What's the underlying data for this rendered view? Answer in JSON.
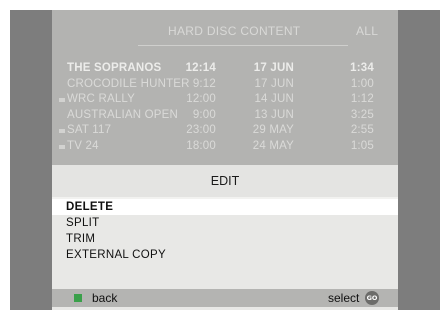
{
  "header": {
    "title": "HARD DISC CONTENT",
    "filter": "ALL"
  },
  "recordings": [
    {
      "name": "THE SOPRANOS",
      "time": "12:14",
      "date": "17 JUN",
      "length": "1:34",
      "marked": false,
      "highlighted": true
    },
    {
      "name": "CROCODILE HUNTER",
      "time": "9:12",
      "date": "17 JUN",
      "length": "1:00",
      "marked": false,
      "highlighted": false
    },
    {
      "name": "WRC RALLY",
      "time": "12:00",
      "date": "14 JUN",
      "length": "1:12",
      "marked": true,
      "highlighted": false
    },
    {
      "name": "AUSTRALIAN OPEN",
      "time": "9:00",
      "date": "13 JUN",
      "length": "3:25",
      "marked": false,
      "highlighted": false
    },
    {
      "name": "SAT 117",
      "time": "23:00",
      "date": "29 MAY",
      "length": "2:55",
      "marked": true,
      "highlighted": false
    },
    {
      "name": "TV 24",
      "time": "18:00",
      "date": "24 MAY",
      "length": "1:05",
      "marked": true,
      "highlighted": false
    }
  ],
  "menu": {
    "title": "EDIT",
    "items": [
      {
        "label": "DELETE",
        "selected": true
      },
      {
        "label": "SPLIT",
        "selected": false
      },
      {
        "label": "TRIM",
        "selected": false
      },
      {
        "label": "EXTERNAL COPY",
        "selected": false
      }
    ]
  },
  "footer": {
    "back_label": "back",
    "select_label": "select",
    "go_label": "GO",
    "back_button_color": "#3aa04a"
  },
  "icons": {
    "back": "green-square-icon",
    "select": "go-button-icon"
  }
}
